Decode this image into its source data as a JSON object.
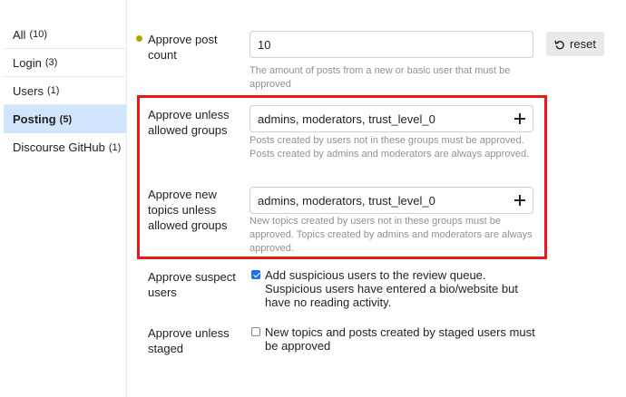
{
  "sidebar": {
    "items": [
      {
        "label": "All",
        "count": "(10)"
      },
      {
        "label": "Login",
        "count": "(3)"
      },
      {
        "label": "Users",
        "count": "(1)"
      },
      {
        "label": "Posting",
        "count": "(5)"
      },
      {
        "label": "Discourse GitHub",
        "count": "(1)"
      }
    ]
  },
  "settings": {
    "approve_post_count": {
      "label": "Approve post count",
      "value": "10",
      "description": "The amount of posts from a new or basic user that must be approved",
      "reset_label": "reset"
    },
    "approve_unless_allowed_groups": {
      "label": "Approve unless allowed groups",
      "value": "admins, moderators, trust_level_0",
      "description": "Posts created by users not in these groups must be approved. Posts created by admins and moderators are always approved."
    },
    "approve_new_topics_unless_allowed_groups": {
      "label": "Approve new topics unless allowed groups",
      "value": "admins, moderators, trust_level_0",
      "description": "New topics created by users not in these groups must be approved. Topics created by admins and moderators are always approved."
    },
    "approve_suspect_users": {
      "label": "Approve suspect users",
      "checked": true,
      "description": "Add suspicious users to the review queue. Suspicious users have entered a bio/website but have no reading activity."
    },
    "approve_unless_staged": {
      "label": "Approve unless staged",
      "checked": false,
      "description": "New topics and posts created by staged users must be approved"
    }
  },
  "colors": {
    "highlight": "#e81919",
    "active_sidebar": "#d1e6fd",
    "modified_dot": "#b5a400"
  }
}
